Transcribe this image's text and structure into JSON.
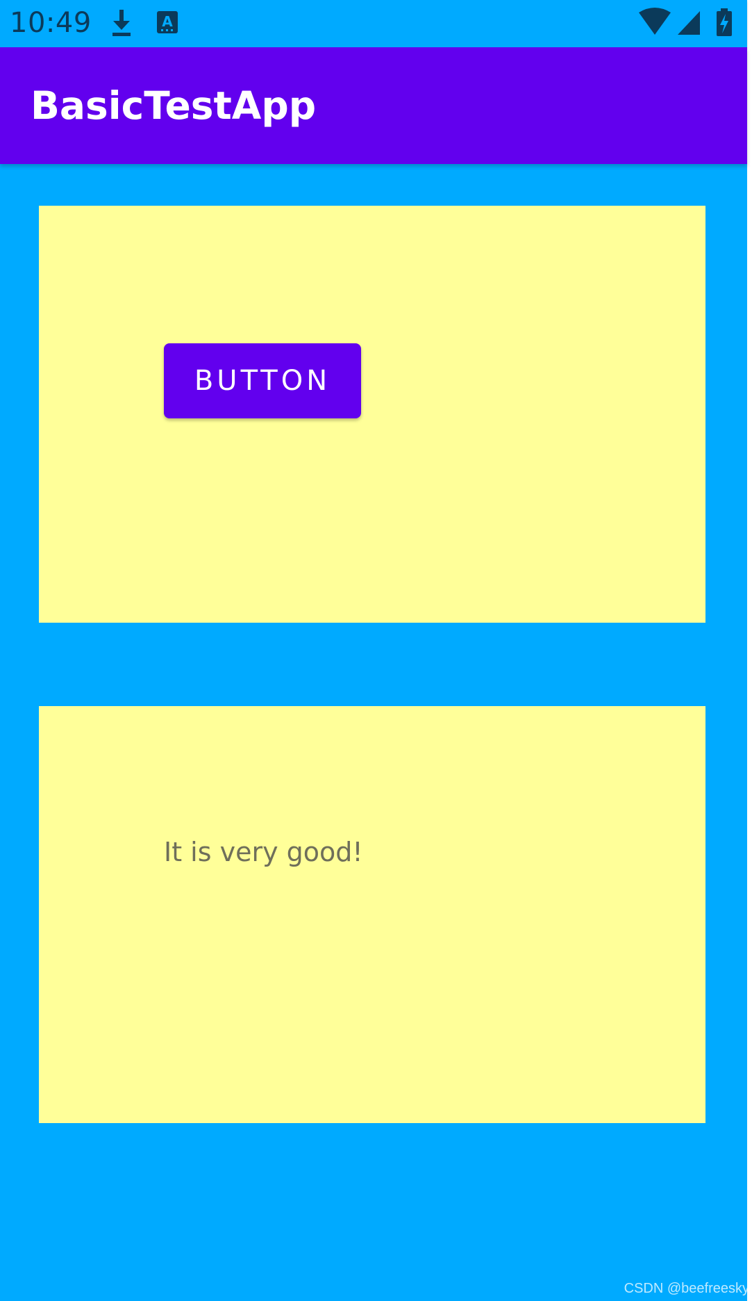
{
  "status_bar": {
    "time": "10:49",
    "icons": [
      "download-icon",
      "keyboard-a-icon",
      "wifi-icon",
      "cell-signal-icon",
      "battery-charging-icon"
    ]
  },
  "app_bar": {
    "title": "BasicTestApp"
  },
  "panel_top": {
    "button_label": "BUTTON"
  },
  "panel_bottom": {
    "message": "It is very good!"
  },
  "watermark": "CSDN @beefreesky",
  "colors": {
    "background": "#00aaff",
    "app_bar": "#6200ee",
    "panel": "#ffff99",
    "button": "#6200ee"
  }
}
